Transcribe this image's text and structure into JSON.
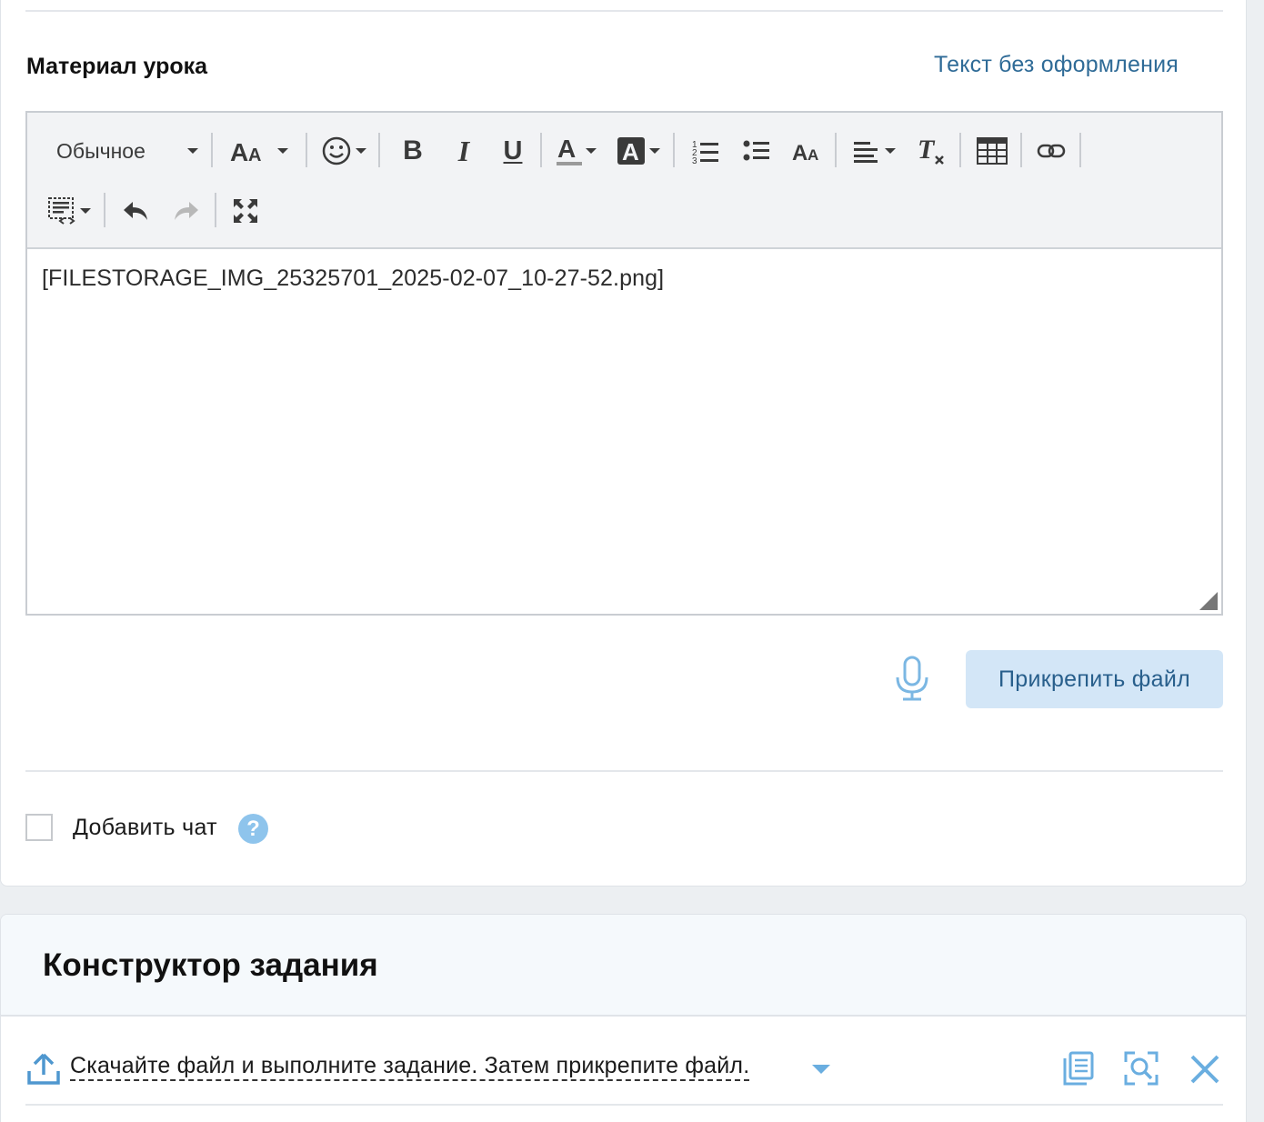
{
  "lesson_material": {
    "title": "Материал урока",
    "plain_text_link": "Текст без оформления",
    "editor": {
      "format_select": "Обычное",
      "content": "[FILESTORAGE_IMG_25325701_2025-02-07_10-27-52.png]"
    },
    "attach_button": "Прикрепить файл",
    "add_chat_label": "Добавить чат",
    "help_glyph": "?"
  },
  "task_builder": {
    "title": "Конструктор задания",
    "task_text": "Скачайте файл и выполните задание. Затем прикрепите файл."
  },
  "colors": {
    "link": "#2f6b97",
    "accent_light": "#d3e6f7",
    "icon_blue": "#6aaee0"
  }
}
